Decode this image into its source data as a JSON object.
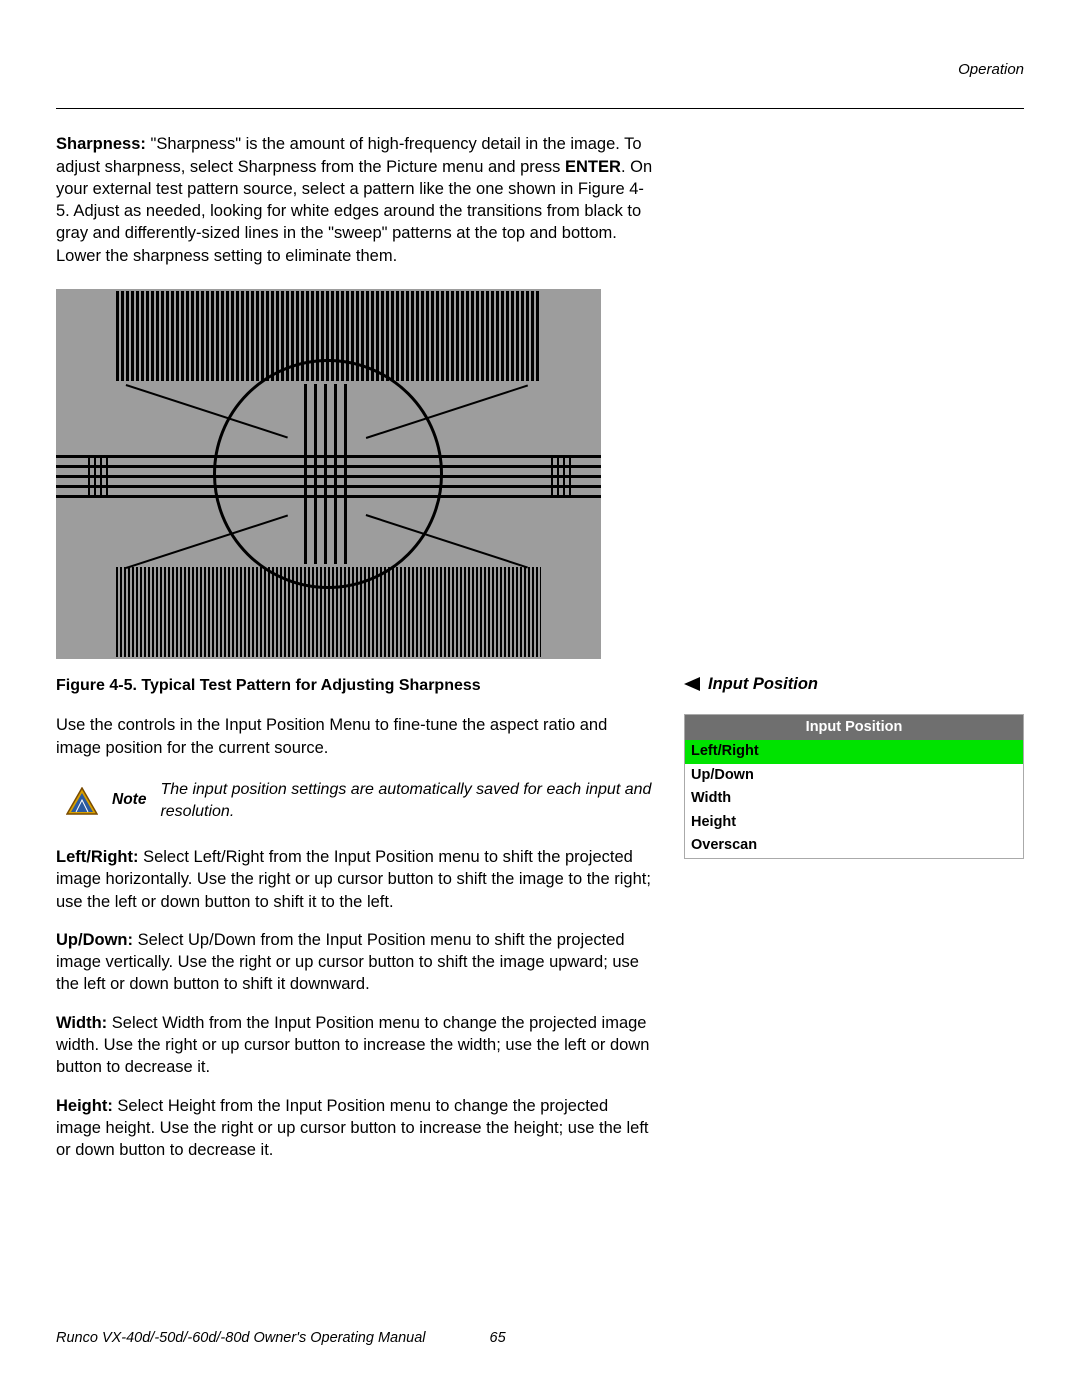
{
  "header": {
    "section": "Operation"
  },
  "sharpness": {
    "label": "Sharpness:",
    "body": " \"Sharpness\" is the amount of high-frequency detail in the image. To adjust sharpness, select Sharpness from the Picture menu and press ",
    "enter": "ENTER",
    "body2": ". On your external test pattern source, select a pattern like the one shown in Figure 4-5. Adjust as needed, looking for white edges around the transitions from black to gray and differently-sized lines in the \"sweep\" patterns at the top and bottom. Lower the sharpness setting to eliminate them."
  },
  "figure": {
    "caption": "Figure 4-5. Typical Test Pattern for Adjusting Sharpness"
  },
  "input_position_intro": "Use the controls in the Input Position Menu to fine-tune the aspect ratio and image position for the current source.",
  "note": {
    "label": "Note",
    "text": "The input position settings are automatically saved for each input and resolution."
  },
  "left_right": {
    "label": "Left/Right:",
    "body": " Select Left/Right from the Input Position menu to shift the projected image horizontally. Use the right or up cursor button to shift the image to the right; use the left or down button to shift it to the left."
  },
  "up_down": {
    "label": "Up/Down:",
    "body": " Select Up/Down from the Input Position menu to shift the projected image vertically. Use the right or up cursor button to shift the image upward; use the left or down button to shift it downward."
  },
  "width": {
    "label": "Width:",
    "body": " Select Width from the Input Position menu to change the projected image width. Use the right or up cursor button to increase the width; use the left or down button to decrease it."
  },
  "height": {
    "label": "Height:",
    "body": " Select Height from the Input Position menu to change the projected image height. Use the right or up cursor button to increase the height; use the left or down button to decrease it."
  },
  "side": {
    "heading": "Input Position",
    "menu_title": "Input Position",
    "items": [
      "Left/Right",
      "Up/Down",
      "Width",
      "Height",
      "Overscan"
    ],
    "selected_index": 0
  },
  "footer": {
    "manual": "Runco VX-40d/-50d/-60d/-80d Owner's Operating Manual",
    "page": "65"
  }
}
